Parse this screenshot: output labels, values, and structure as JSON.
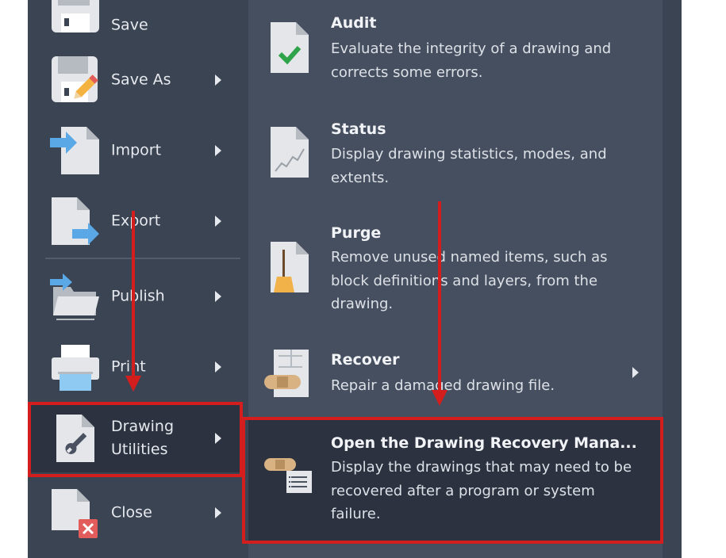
{
  "left_menu": {
    "items": [
      {
        "label": "Save",
        "icon": "save-disk-icon",
        "has_submenu": false
      },
      {
        "label": "Save As",
        "icon": "save-as-disk-pencil-icon",
        "has_submenu": true
      },
      {
        "label": "Import",
        "icon": "import-document-icon",
        "has_submenu": true
      },
      {
        "label": "Export",
        "icon": "export-document-icon",
        "has_submenu": true
      },
      {
        "label": "Publish",
        "icon": "publish-folder-icon",
        "has_submenu": true
      },
      {
        "label": "Print",
        "icon": "printer-icon",
        "has_submenu": true
      },
      {
        "label": "Drawing\nUtilities",
        "icon": "wrench-document-icon",
        "has_submenu": true
      },
      {
        "label": "Close",
        "icon": "close-document-icon",
        "has_submenu": true
      }
    ]
  },
  "submenu": {
    "items": [
      {
        "title": "Audit",
        "desc": "Evaluate the integrity of a drawing and corrects some errors.",
        "icon": "audit-check-icon"
      },
      {
        "title": "Status",
        "desc": "Display drawing statistics, modes, and extents.",
        "icon": "status-chart-icon"
      },
      {
        "title": "Purge",
        "desc": "Remove unused named items, such as block definitions and layers, from the drawing.",
        "icon": "purge-broom-icon"
      },
      {
        "title": "Recover",
        "desc": "Repair a damaged drawing file.",
        "icon": "recover-bandage-icon"
      },
      {
        "title": "Open the Drawing Recovery Mana...",
        "desc": "Display the drawings that may need to be recovered after a program or system failure.",
        "icon": "recovery-manager-icon"
      }
    ]
  },
  "colors": {
    "left_bg": "#3b4453",
    "right_bg": "#454f5f",
    "active_bg": "#2c3240",
    "annotation_red": "#d41e1e"
  }
}
